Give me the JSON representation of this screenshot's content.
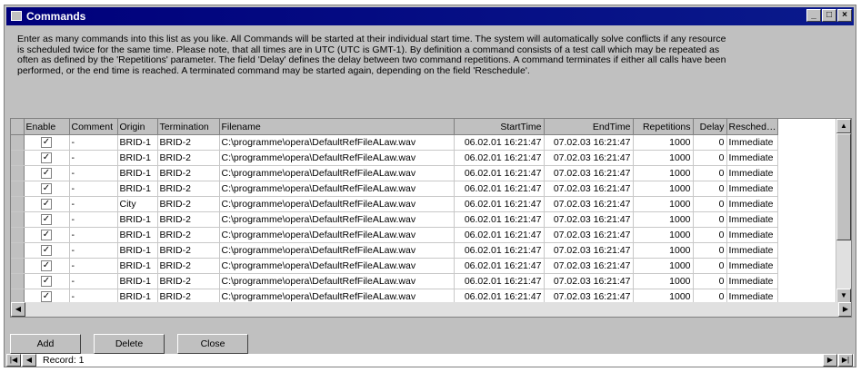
{
  "window": {
    "title": "Commands",
    "controls": [
      "_",
      "□",
      "×"
    ]
  },
  "description": "Enter as many commands into this list as you like. All Commands will be started at their individual start time. The system will automatically solve conflicts if any resource is scheduled twice for the same time. Please note, that all times are in UTC (UTC is GMT-1). By definition a command consists of a test call which may be repeated as often as defined by the 'Repetitions' parameter. The field 'Delay' defines the delay between two command repetitions. A command terminates if either all calls have been performed, or the end time is reached. A terminated command may be started again, depending on the field 'Reschedule'.",
  "table": {
    "headers": [
      "Enable",
      "Comment",
      "Origin",
      "Termination",
      "Filename",
      "StartTime",
      "EndTime",
      "Repetitions",
      "Delay",
      "Resched…"
    ],
    "rows": [
      {
        "comment": "-",
        "origin": "BRID-1",
        "termination": "BRID-2",
        "filename": "C:\\programme\\opera\\DefaultRefFileALaw.wav",
        "start": "06.02.01 16:21:47",
        "end": "07.02.03 16:21:47",
        "reps": "1000",
        "delay": "0",
        "resched": "Immediate"
      },
      {
        "comment": "-",
        "origin": "BRID-1",
        "termination": "BRID-2",
        "filename": "C:\\programme\\opera\\DefaultRefFileALaw.wav",
        "start": "06.02.01 16:21:47",
        "end": "07.02.03 16:21:47",
        "reps": "1000",
        "delay": "0",
        "resched": "Immediate"
      },
      {
        "comment": "-",
        "origin": "BRID-1",
        "termination": "BRID-2",
        "filename": "C:\\programme\\opera\\DefaultRefFileALaw.wav",
        "start": "06.02.01 16:21:47",
        "end": "07.02.03 16:21:47",
        "reps": "1000",
        "delay": "0",
        "resched": "Immediate"
      },
      {
        "comment": "-",
        "origin": "BRID-1",
        "termination": "BRID-2",
        "filename": "C:\\programme\\opera\\DefaultRefFileALaw.wav",
        "start": "06.02.01 16:21:47",
        "end": "07.02.03 16:21:47",
        "reps": "1000",
        "delay": "0",
        "resched": "Immediate"
      },
      {
        "comment": "-",
        "origin": "City",
        "termination": "BRID-2",
        "filename": "C:\\programme\\opera\\DefaultRefFileALaw.wav",
        "start": "06.02.01 16:21:47",
        "end": "07.02.03 16:21:47",
        "reps": "1000",
        "delay": "0",
        "resched": "Immediate"
      },
      {
        "comment": "-",
        "origin": "BRID-1",
        "termination": "BRID-2",
        "filename": "C:\\programme\\opera\\DefaultRefFileALaw.wav",
        "start": "06.02.01 16:21:47",
        "end": "07.02.03 16:21:47",
        "reps": "1000",
        "delay": "0",
        "resched": "Immediate"
      },
      {
        "comment": "-",
        "origin": "BRID-1",
        "termination": "BRID-2",
        "filename": "C:\\programme\\opera\\DefaultRefFileALaw.wav",
        "start": "06.02.01 16:21:47",
        "end": "07.02.03 16:21:47",
        "reps": "1000",
        "delay": "0",
        "resched": "Immediate"
      },
      {
        "comment": "-",
        "origin": "BRID-1",
        "termination": "BRID-2",
        "filename": "C:\\programme\\opera\\DefaultRefFileALaw.wav",
        "start": "06.02.01 16:21:47",
        "end": "07.02.03 16:21:47",
        "reps": "1000",
        "delay": "0",
        "resched": "Immediate"
      },
      {
        "comment": "-",
        "origin": "BRID-1",
        "termination": "BRID-2",
        "filename": "C:\\programme\\opera\\DefaultRefFileALaw.wav",
        "start": "06.02.01 16:21:47",
        "end": "07.02.03 16:21:47",
        "reps": "1000",
        "delay": "0",
        "resched": "Immediate"
      },
      {
        "comment": "-",
        "origin": "BRID-1",
        "termination": "BRID-2",
        "filename": "C:\\programme\\opera\\DefaultRefFileALaw.wav",
        "start": "06.02.01 16:21:47",
        "end": "07.02.03 16:21:47",
        "reps": "1000",
        "delay": "0",
        "resched": "Immediate"
      },
      {
        "comment": "-",
        "origin": "BRID-1",
        "termination": "BRID-2",
        "filename": "C:\\programme\\opera\\DefaultRefFileALaw.wav",
        "start": "06.02.01 16:21:47",
        "end": "07.02.03 16:21:47",
        "reps": "1000",
        "delay": "0",
        "resched": "Immediate"
      }
    ]
  },
  "buttons": {
    "add": "Add",
    "delete": "Delete",
    "close": "Close"
  },
  "navigator": {
    "record_label": "Record: 1"
  }
}
